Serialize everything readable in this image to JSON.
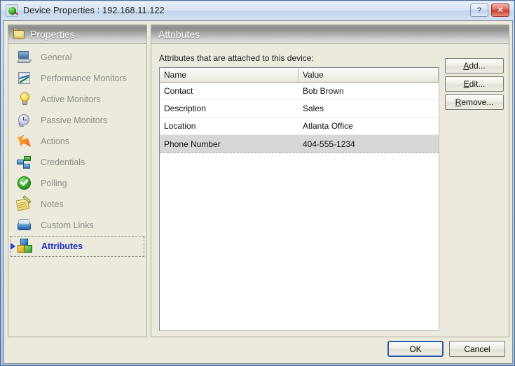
{
  "window": {
    "title": "Device Properties : 192.168.11.122",
    "icon": "device-globe-icon",
    "help_label": "?",
    "close_label": "✕"
  },
  "sidebar": {
    "header": {
      "title": "Properties",
      "icon": "folder-icon"
    },
    "items": [
      {
        "label": "General",
        "icon": "monitor-icon",
        "selected": false
      },
      {
        "label": "Performance Monitors",
        "icon": "chart-grid-icon",
        "selected": false
      },
      {
        "label": "Active Monitors",
        "icon": "lightbulb-icon",
        "selected": false
      },
      {
        "label": "Passive Monitors",
        "icon": "clock-icon",
        "selected": false
      },
      {
        "label": "Actions",
        "icon": "lightning-bolt-icon",
        "selected": false
      },
      {
        "label": "Credentials",
        "icon": "network-nodes-icon",
        "selected": false
      },
      {
        "label": "Polling",
        "icon": "green-check-icon",
        "selected": false
      },
      {
        "label": "Notes",
        "icon": "notepad-pencil-icon",
        "selected": false
      },
      {
        "label": "Custom Links",
        "icon": "link-database-icon",
        "selected": false
      },
      {
        "label": "Attributes",
        "icon": "colored-cubes-icon",
        "selected": true
      }
    ]
  },
  "panel": {
    "title": "Attributes",
    "caption": "Attributes that are attached to this device:",
    "table": {
      "columns": [
        "Name",
        "Value"
      ],
      "rows": [
        {
          "name": "Contact",
          "value": "Bob Brown",
          "selected": false
        },
        {
          "name": "Description",
          "value": "Sales",
          "selected": false
        },
        {
          "name": "Location",
          "value": "Atlanta Office",
          "selected": false
        },
        {
          "name": "Phone Number",
          "value": "404-555-1234",
          "selected": true
        }
      ]
    },
    "buttons": [
      {
        "accel": "A",
        "rest": "dd...",
        "name": "add"
      },
      {
        "accel": "E",
        "rest": "dit...",
        "name": "edit"
      },
      {
        "accel": "R",
        "rest": "emove...",
        "name": "remove"
      }
    ]
  },
  "footer": {
    "ok_label": "OK",
    "cancel_label": "Cancel"
  },
  "colors": {
    "frame": "#4a6c9b",
    "selection_text": "#1a2ec4",
    "row_selected_bg": "#d7d7d7",
    "panel_bg": "#ece9dd",
    "default_button_border": "#2a5ca8"
  }
}
